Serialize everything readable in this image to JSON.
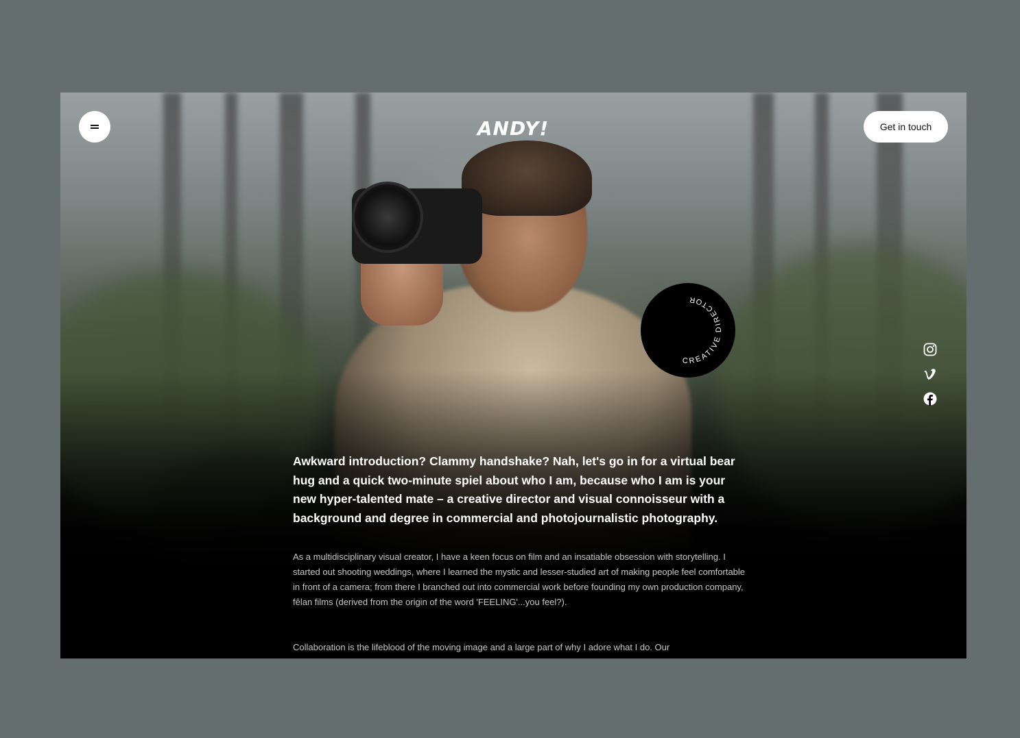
{
  "header": {
    "menu_icon": "hamburger-icon",
    "logo": "ANDY!",
    "cta_label": "Get in touch"
  },
  "badge": {
    "text": "CREATIVE DIRECTOR"
  },
  "social": [
    {
      "name": "instagram",
      "icon": "instagram-icon"
    },
    {
      "name": "vimeo",
      "icon": "vimeo-icon"
    },
    {
      "name": "facebook",
      "icon": "facebook-icon"
    }
  ],
  "content": {
    "intro": "Awkward introduction? Clammy handshake? Nah, let's go in for a virtual bear hug and a quick two-minute spiel about who I am, because who I am is your new hyper-talented mate – a creative director and visual connoisseur with a background and degree in commercial and photojournalistic photography.",
    "paragraph_1": "As a multidisciplinary visual creator, I have a keen focus on film and an insatiable obsession with storytelling. I started out shooting weddings, where I learned the mystic and lesser-studied art of making people feel comfortable in front of a camera; from there I branched out into commercial work before founding my own production company, fêlan films (derived from the origin of the word 'FEELING'...you feel?).",
    "paragraph_2": "Collaboration is the lifeblood of the moving image and a large part of why I adore what I do. Our"
  },
  "colors": {
    "page_background": "#656e6f",
    "frame_background": "#000000",
    "button_background": "#ffffff",
    "text_primary": "#ffffff",
    "text_secondary": "#c7c7c7"
  }
}
